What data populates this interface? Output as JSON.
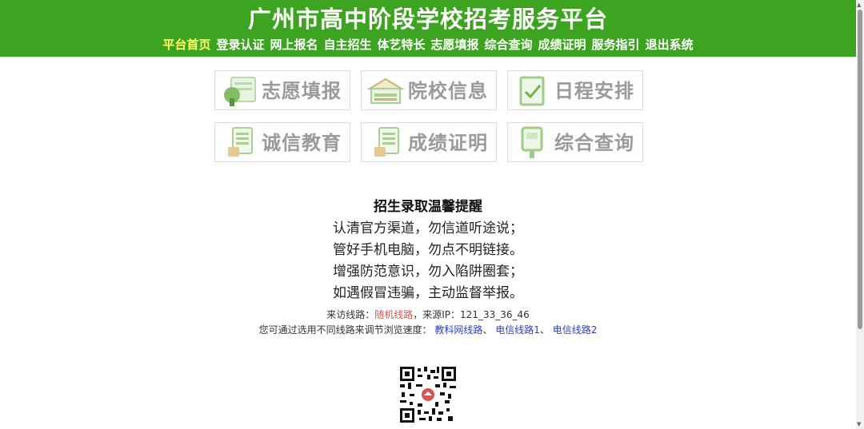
{
  "header": {
    "title": "广州市高中阶段学校招考服务平台",
    "nav": [
      {
        "label": "平台首页",
        "active": true
      },
      {
        "label": "登录认证",
        "active": false
      },
      {
        "label": "网上报名",
        "active": false
      },
      {
        "label": "自主招生",
        "active": false
      },
      {
        "label": "体艺特长",
        "active": false
      },
      {
        "label": "志愿填报",
        "active": false
      },
      {
        "label": "综合查询",
        "active": false
      },
      {
        "label": "成绩证明",
        "active": false
      },
      {
        "label": "服务指引",
        "active": false
      },
      {
        "label": "退出系统",
        "active": false
      }
    ]
  },
  "tiles": [
    {
      "label": "志愿填报",
      "icon": "volunteer-fill-icon"
    },
    {
      "label": "院校信息",
      "icon": "school-info-icon"
    },
    {
      "label": "日程安排",
      "icon": "schedule-icon"
    },
    {
      "label": "诚信教育",
      "icon": "integrity-education-icon"
    },
    {
      "label": "成绩证明",
      "icon": "score-certificate-icon"
    },
    {
      "label": "综合查询",
      "icon": "query-icon"
    }
  ],
  "notice": {
    "title": "招生录取温馨提醒",
    "lines": [
      "认清官方渠道，勿信道听途说；",
      "管好手机电脑，勿点不明链接。",
      "增强防范意识，勿入陷阱圈套；",
      "如遇假冒违骗，主动监督举报。"
    ],
    "route_prefix": "来访线路：",
    "route_value": "随机线路",
    "source_prefix": "，来源IP：",
    "source_ip": "121_33_36_46",
    "switch_prefix": "您可通过选用不同线路来调节浏览速度：",
    "routes": [
      "教科网线路",
      "电信线路1",
      "电信线路2"
    ],
    "separator": "、"
  },
  "colors": {
    "header_bg": "#3da421",
    "active_nav": "#ffff66",
    "link": "#2a3fbf",
    "highlight": "#d9534f"
  }
}
